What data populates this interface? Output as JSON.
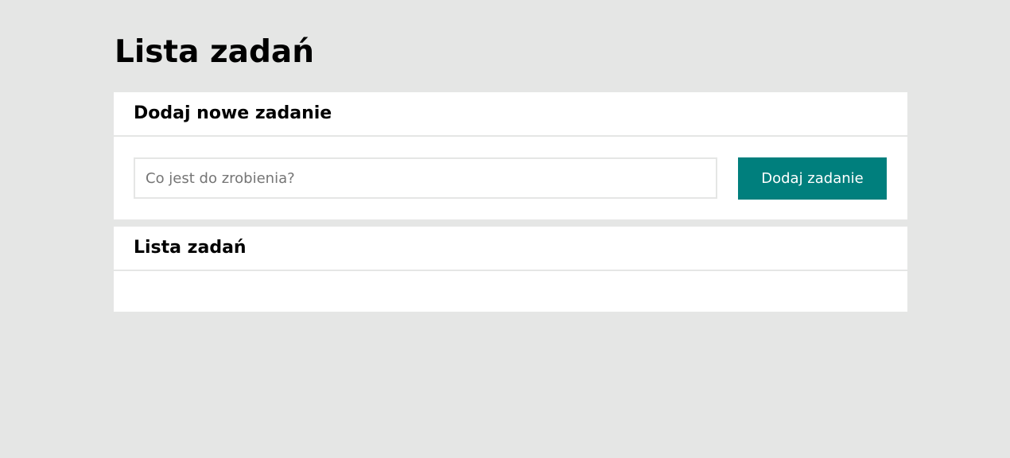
{
  "page": {
    "title": "Lista zadań"
  },
  "add_panel": {
    "heading": "Dodaj nowe zadanie",
    "input_placeholder": "Co jest do zrobienia?",
    "input_value": "",
    "button_label": "Dodaj zadanie"
  },
  "list_panel": {
    "heading": "Lista zadań",
    "items": []
  },
  "colors": {
    "background": "#e5e6e5",
    "panel": "#ffffff",
    "accent": "#007f7d",
    "button_text": "#ffffff"
  }
}
